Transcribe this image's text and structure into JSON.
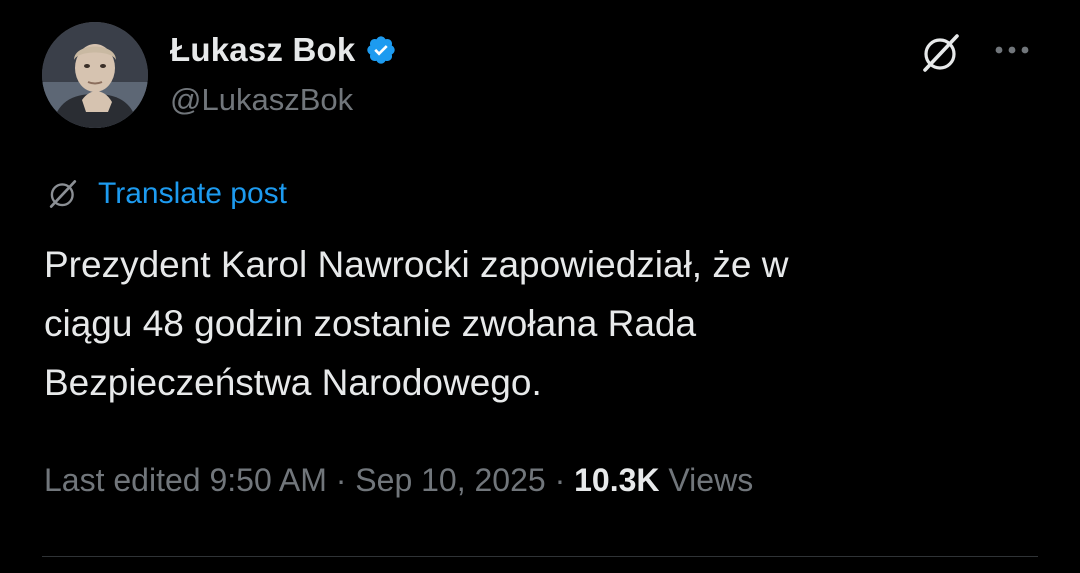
{
  "author": {
    "display_name": "Łukasz Bok",
    "handle": "@LukaszBok",
    "verified": true,
    "verified_color": "#1d9bf0"
  },
  "actions": {
    "grok_icon": "grok-icon",
    "more_icon": "more-options-icon",
    "more_label": "···"
  },
  "translate": {
    "label": "Translate post",
    "icon": "grok-icon",
    "color": "#1d9bf0"
  },
  "tweet": {
    "text": "Prezydent Karol Nawrocki zapowiedział, że w\nciągu 48 godzin zostanie zwołana Rada\nBezpieczeństwa Narodowego."
  },
  "meta": {
    "edited_prefix": "Last edited",
    "time": "9:50 AM",
    "separator": " · ",
    "date": "Sep 10, 2025",
    "views_count": "10.3K",
    "views_label": "Views"
  },
  "colors": {
    "background": "#000000",
    "primary_text": "#e7e9ea",
    "secondary_text": "#71767b",
    "accent": "#1d9bf0",
    "divider": "#2f3336"
  }
}
